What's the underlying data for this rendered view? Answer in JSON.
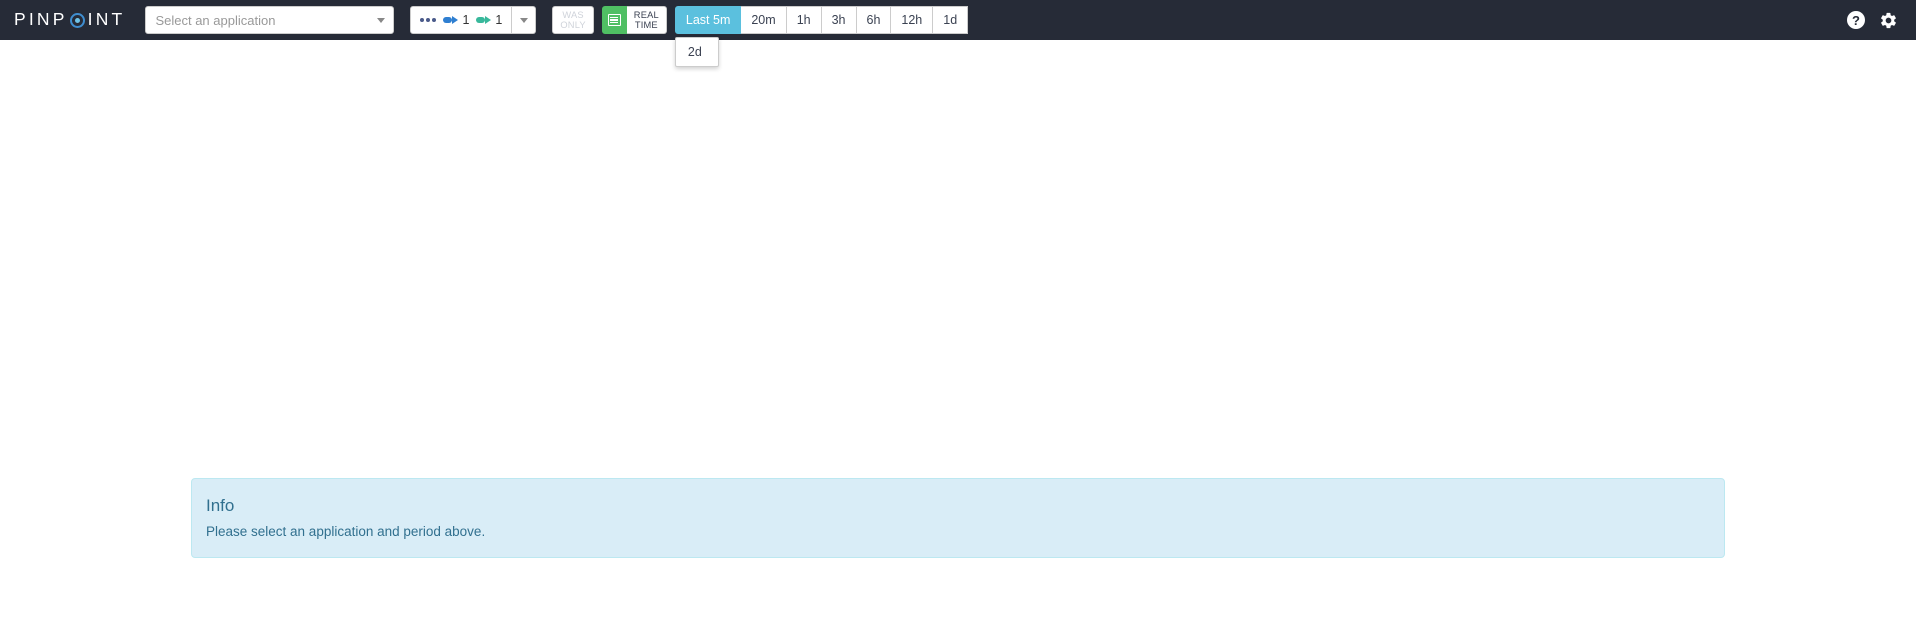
{
  "header": {
    "logo": {
      "part1": "PINP",
      "target_icon": "target-ring-icon",
      "part2": "INT"
    },
    "app_select": {
      "placeholder": "Select an application",
      "value": "",
      "caret_icon": "chevron-down-icon"
    },
    "counters": {
      "dots_icon": "more-dots-icon",
      "inbound": {
        "icon": "arrow-right-blue-icon",
        "value": "1"
      },
      "outbound": {
        "icon": "arrow-right-green-icon",
        "value": "1"
      },
      "caret_icon": "chevron-down-icon"
    },
    "was_only": {
      "line1": "WAS",
      "line2": "ONLY",
      "enabled": false
    },
    "grid_toggle": {
      "icon": "table-grid-icon",
      "active": true
    },
    "real_time": {
      "line1": "REAL",
      "line2": "TIME"
    },
    "periods": [
      {
        "label": "Last 5m",
        "active": true
      },
      {
        "label": "20m",
        "active": false
      },
      {
        "label": "1h",
        "active": false
      },
      {
        "label": "3h",
        "active": false
      },
      {
        "label": "6h",
        "active": false
      },
      {
        "label": "12h",
        "active": false
      },
      {
        "label": "1d",
        "active": false
      }
    ],
    "period_dropdown": {
      "open": true,
      "items": [
        {
          "label": "2d"
        }
      ]
    },
    "help_icon": "question-mark-circle-icon",
    "settings_icon": "gear-icon"
  },
  "main": {
    "info": {
      "title": "Info",
      "message": "Please select an application and period above."
    }
  },
  "colors": {
    "header_bg": "#262b37",
    "accent_active": "#5bc0de",
    "green": "#4fbf63",
    "info_bg": "#d9edf7",
    "info_border": "#bce8f1",
    "info_text": "#31708f",
    "logo_ring": "#3f8ed0"
  }
}
